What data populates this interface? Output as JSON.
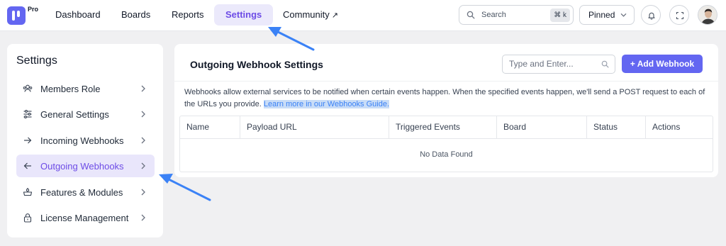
{
  "header": {
    "pro_label": "Pro",
    "nav": [
      {
        "label": "Dashboard"
      },
      {
        "label": "Boards"
      },
      {
        "label": "Reports"
      },
      {
        "label": "Settings",
        "active": true
      },
      {
        "label": "Community",
        "external": true
      }
    ],
    "search": {
      "label": "Search",
      "shortcut": "⌘ k"
    },
    "pinned_label": "Pinned",
    "icons": [
      "bell-icon",
      "fullscreen-icon",
      "avatar"
    ]
  },
  "sidebar": {
    "title": "Settings",
    "items": [
      {
        "label": "Members Role",
        "icon": "members-icon"
      },
      {
        "label": "General Settings",
        "icon": "sliders-icon"
      },
      {
        "label": "Incoming Webhooks",
        "icon": "arrow-right-icon"
      },
      {
        "label": "Outgoing Webhooks",
        "icon": "arrow-left-icon",
        "active": true
      },
      {
        "label": "Features & Modules",
        "icon": "modules-icon"
      },
      {
        "label": "License Management",
        "icon": "lock-icon"
      }
    ]
  },
  "main": {
    "title": "Outgoing Webhook Settings",
    "search_placeholder": "Type and Enter...",
    "add_button": "+ Add Webhook",
    "description": "Webhooks allow external services to be notified when certain events happen. When the specified events happen, we'll send a POST request to each of the URLs you provide.",
    "link_text": "Learn more in our Webhooks Guide.",
    "table": {
      "columns": [
        "Name",
        "Payload URL",
        "Triggered Events",
        "Board",
        "Status",
        "Actions"
      ],
      "empty_text": "No Data Found"
    }
  },
  "colors": {
    "accent": "#6366f1",
    "active_bg": "#ebe9fb",
    "active_text": "#6d4ce6",
    "annotation_arrow": "#3b82f6"
  }
}
